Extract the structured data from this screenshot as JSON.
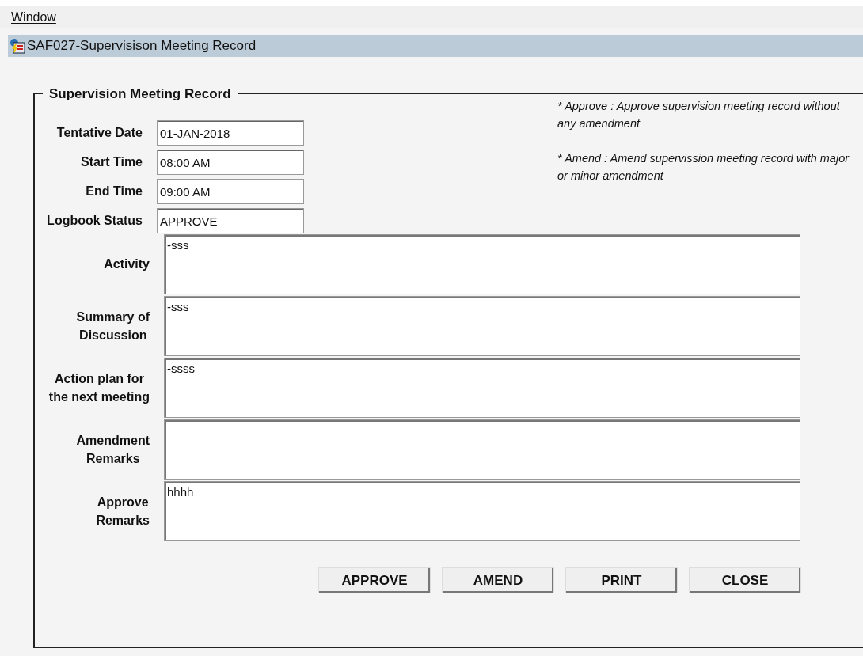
{
  "menu": [
    {
      "label": "Window"
    }
  ],
  "window": {
    "title": "SAF027-Supervisison Meeting Record"
  },
  "group": {
    "title": "Supervision Meeting Record"
  },
  "notes": [
    "* Approve : Approve supervision meeting record without any amendment",
    "* Amend : Amend supervission meeting record with major or minor amendment"
  ],
  "short_fields": [
    {
      "label": "Tentative Date",
      "value": "01-JAN-2018"
    },
    {
      "label": "Start Time",
      "value": "08:00 AM"
    },
    {
      "label": "End Time",
      "value": "09:00 AM"
    },
    {
      "label": "Logbook Status",
      "value": "APPROVE"
    }
  ],
  "text_areas": [
    {
      "label": "Activity",
      "value": "-sss"
    },
    {
      "label": "Summary of\nDiscussion",
      "value": "-sss"
    },
    {
      "label": "Action plan for\nthe next meeting",
      "value": "-ssss"
    },
    {
      "label": "Amendment\nRemarks"
    },
    {
      "label": "Approve\nRemarks",
      "value": "hhhh"
    }
  ],
  "buttons": [
    "APPROVE",
    "AMEND",
    "PRINT",
    "CLOSE"
  ]
}
